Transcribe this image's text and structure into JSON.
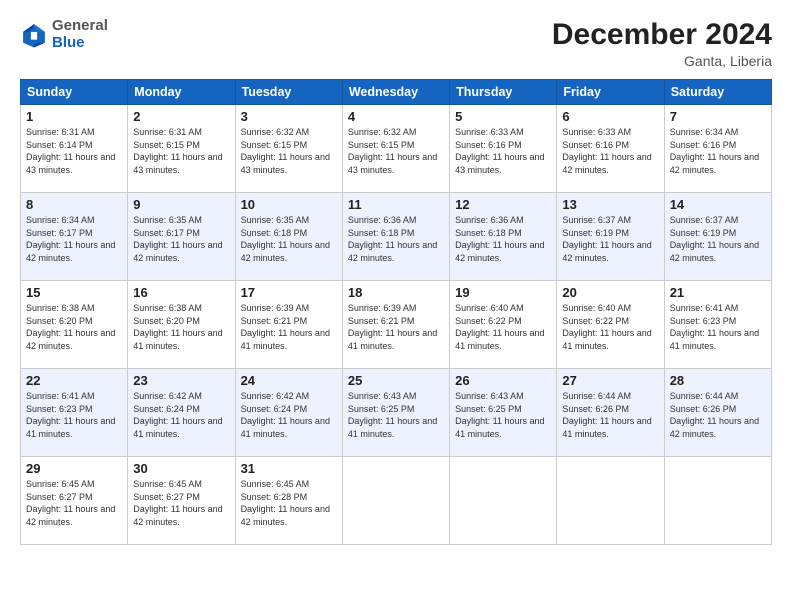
{
  "logo": {
    "general": "General",
    "blue": "Blue"
  },
  "title": {
    "month": "December 2024",
    "location": "Ganta, Liberia"
  },
  "weekdays": [
    "Sunday",
    "Monday",
    "Tuesday",
    "Wednesday",
    "Thursday",
    "Friday",
    "Saturday"
  ],
  "weeks": [
    [
      {
        "day": "1",
        "sunrise": "6:31 AM",
        "sunset": "6:14 PM",
        "daylight": "11 hours and 43 minutes."
      },
      {
        "day": "2",
        "sunrise": "6:31 AM",
        "sunset": "6:15 PM",
        "daylight": "11 hours and 43 minutes."
      },
      {
        "day": "3",
        "sunrise": "6:32 AM",
        "sunset": "6:15 PM",
        "daylight": "11 hours and 43 minutes."
      },
      {
        "day": "4",
        "sunrise": "6:32 AM",
        "sunset": "6:15 PM",
        "daylight": "11 hours and 43 minutes."
      },
      {
        "day": "5",
        "sunrise": "6:33 AM",
        "sunset": "6:16 PM",
        "daylight": "11 hours and 43 minutes."
      },
      {
        "day": "6",
        "sunrise": "6:33 AM",
        "sunset": "6:16 PM",
        "daylight": "11 hours and 42 minutes."
      },
      {
        "day": "7",
        "sunrise": "6:34 AM",
        "sunset": "6:16 PM",
        "daylight": "11 hours and 42 minutes."
      }
    ],
    [
      {
        "day": "8",
        "sunrise": "6:34 AM",
        "sunset": "6:17 PM",
        "daylight": "11 hours and 42 minutes."
      },
      {
        "day": "9",
        "sunrise": "6:35 AM",
        "sunset": "6:17 PM",
        "daylight": "11 hours and 42 minutes."
      },
      {
        "day": "10",
        "sunrise": "6:35 AM",
        "sunset": "6:18 PM",
        "daylight": "11 hours and 42 minutes."
      },
      {
        "day": "11",
        "sunrise": "6:36 AM",
        "sunset": "6:18 PM",
        "daylight": "11 hours and 42 minutes."
      },
      {
        "day": "12",
        "sunrise": "6:36 AM",
        "sunset": "6:18 PM",
        "daylight": "11 hours and 42 minutes."
      },
      {
        "day": "13",
        "sunrise": "6:37 AM",
        "sunset": "6:19 PM",
        "daylight": "11 hours and 42 minutes."
      },
      {
        "day": "14",
        "sunrise": "6:37 AM",
        "sunset": "6:19 PM",
        "daylight": "11 hours and 42 minutes."
      }
    ],
    [
      {
        "day": "15",
        "sunrise": "6:38 AM",
        "sunset": "6:20 PM",
        "daylight": "11 hours and 42 minutes."
      },
      {
        "day": "16",
        "sunrise": "6:38 AM",
        "sunset": "6:20 PM",
        "daylight": "11 hours and 41 minutes."
      },
      {
        "day": "17",
        "sunrise": "6:39 AM",
        "sunset": "6:21 PM",
        "daylight": "11 hours and 41 minutes."
      },
      {
        "day": "18",
        "sunrise": "6:39 AM",
        "sunset": "6:21 PM",
        "daylight": "11 hours and 41 minutes."
      },
      {
        "day": "19",
        "sunrise": "6:40 AM",
        "sunset": "6:22 PM",
        "daylight": "11 hours and 41 minutes."
      },
      {
        "day": "20",
        "sunrise": "6:40 AM",
        "sunset": "6:22 PM",
        "daylight": "11 hours and 41 minutes."
      },
      {
        "day": "21",
        "sunrise": "6:41 AM",
        "sunset": "6:23 PM",
        "daylight": "11 hours and 41 minutes."
      }
    ],
    [
      {
        "day": "22",
        "sunrise": "6:41 AM",
        "sunset": "6:23 PM",
        "daylight": "11 hours and 41 minutes."
      },
      {
        "day": "23",
        "sunrise": "6:42 AM",
        "sunset": "6:24 PM",
        "daylight": "11 hours and 41 minutes."
      },
      {
        "day": "24",
        "sunrise": "6:42 AM",
        "sunset": "6:24 PM",
        "daylight": "11 hours and 41 minutes."
      },
      {
        "day": "25",
        "sunrise": "6:43 AM",
        "sunset": "6:25 PM",
        "daylight": "11 hours and 41 minutes."
      },
      {
        "day": "26",
        "sunrise": "6:43 AM",
        "sunset": "6:25 PM",
        "daylight": "11 hours and 41 minutes."
      },
      {
        "day": "27",
        "sunrise": "6:44 AM",
        "sunset": "6:26 PM",
        "daylight": "11 hours and 41 minutes."
      },
      {
        "day": "28",
        "sunrise": "6:44 AM",
        "sunset": "6:26 PM",
        "daylight": "11 hours and 42 minutes."
      }
    ],
    [
      {
        "day": "29",
        "sunrise": "6:45 AM",
        "sunset": "6:27 PM",
        "daylight": "11 hours and 42 minutes."
      },
      {
        "day": "30",
        "sunrise": "6:45 AM",
        "sunset": "6:27 PM",
        "daylight": "11 hours and 42 minutes."
      },
      {
        "day": "31",
        "sunrise": "6:45 AM",
        "sunset": "6:28 PM",
        "daylight": "11 hours and 42 minutes."
      },
      null,
      null,
      null,
      null
    ]
  ]
}
